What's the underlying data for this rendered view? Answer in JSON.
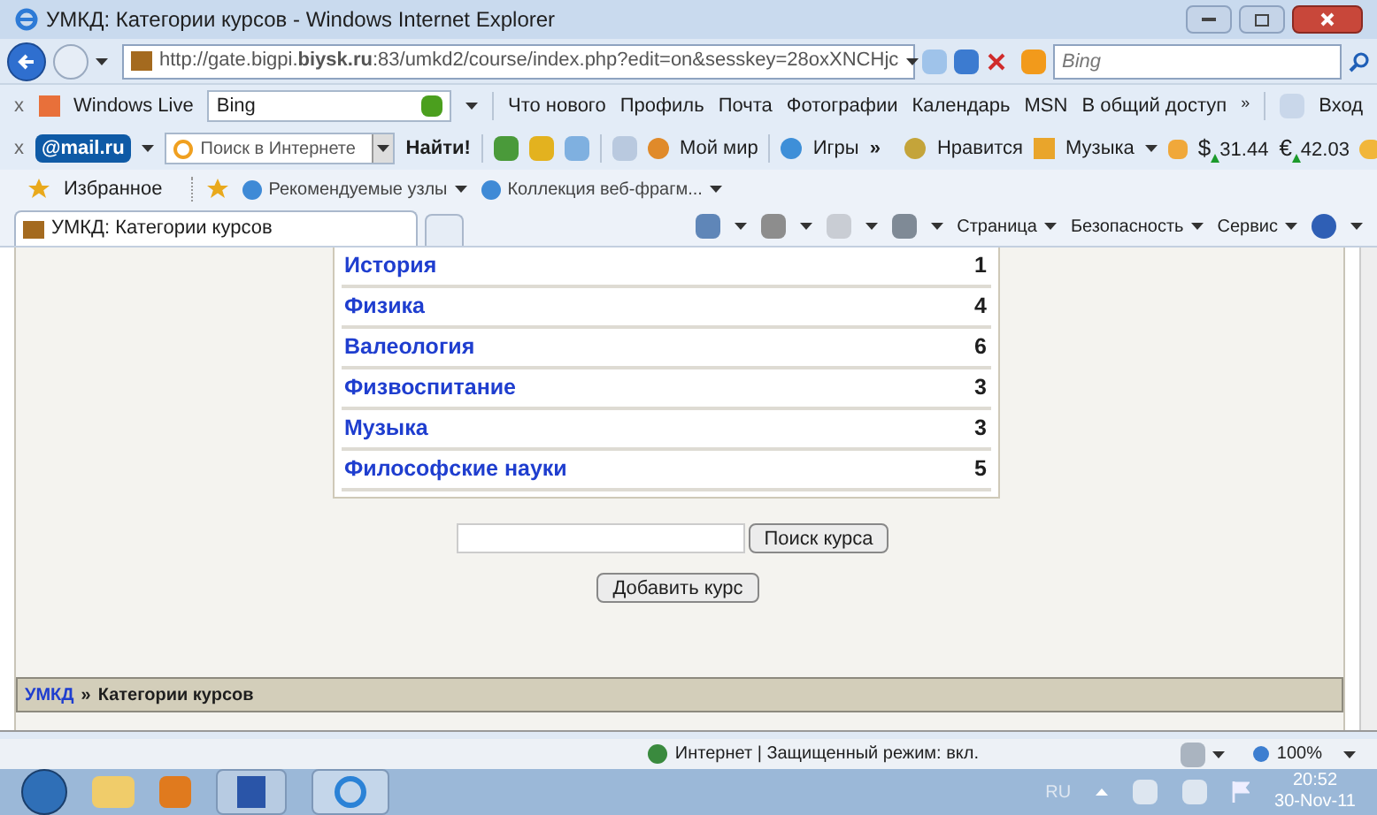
{
  "window": {
    "title": "УМКД: Категории курсов - Windows Internet Explorer"
  },
  "address_bar": {
    "url": "http://gate.bigpi.**biysk.ru**:83/umkd2/course/index.php?edit=on&sesskey=28oxXNCHjc",
    "search_placeholder": "Bing"
  },
  "live_toolbar": {
    "close": "x",
    "label": "Windows Live",
    "search_value": "Bing",
    "links": [
      "Что нового",
      "Профиль",
      "Почта",
      "Фотографии",
      "Календарь",
      "MSN",
      "В общий доступ"
    ],
    "more": "»",
    "sign_in": "Вход"
  },
  "mail_toolbar": {
    "close": "x",
    "logo": "@mail.ru",
    "search_placeholder": "Поиск в Интернете",
    "find_button": "Найти!",
    "links": [
      "Мой мир",
      "Игры"
    ],
    "more": "»",
    "likes": "Нравится",
    "music": "Музыка",
    "rates": [
      {
        "symbol": "$",
        "value": "31.44"
      },
      {
        "symbol": "€",
        "value": "42.03"
      }
    ]
  },
  "favorites_bar": {
    "favorites": "Избранное",
    "links": [
      "Рекомендуемые узлы",
      "Коллекция веб-фрагм..."
    ]
  },
  "tab": {
    "title": "УМКД: Категории курсов",
    "selected": true
  },
  "command_bar": {
    "menus": [
      "Страница",
      "Безопасность",
      "Сервис"
    ]
  },
  "categories": [
    {
      "name": "История",
      "count": "1"
    },
    {
      "name": "Физика",
      "count": "4"
    },
    {
      "name": "Валеология",
      "count": "6"
    },
    {
      "name": "Физвоспитание",
      "count": "3"
    },
    {
      "name": "Музыка",
      "count": "3"
    },
    {
      "name": "Философские науки",
      "count": "5"
    }
  ],
  "search_button": "Поиск курса",
  "add_button": "Добавить курс",
  "breadcrumb": {
    "home": "УМКД",
    "separator": "»",
    "current": "Категории курсов"
  },
  "status_bar": {
    "text": "Интернет | Защищенный режим: вкл.",
    "zoom": "100%"
  },
  "taskbar": {
    "language": "RU",
    "time": "20:52",
    "date": "30-Nov-11"
  }
}
